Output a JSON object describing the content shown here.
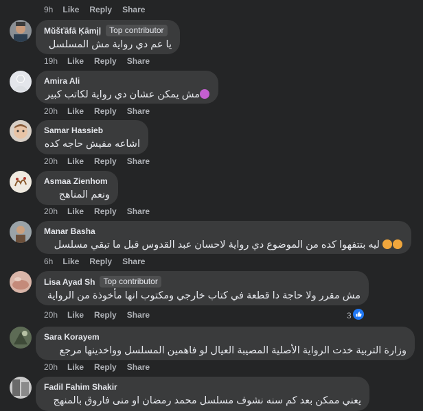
{
  "labels": {
    "like": "Like",
    "reply": "Reply",
    "share": "Share"
  },
  "top_actions": {
    "time": "9h"
  },
  "comments": [
    {
      "author": "Mŭšťāfā Ķāmįļ",
      "badge": "Top contributor",
      "text": "يا عم دي رواية مش المسلسل",
      "time": "19h"
    },
    {
      "author": "Amira Ali",
      "badge": "",
      "text": "مش يمكن عشان دي رواية لكاتب كبير",
      "time": "20h"
    },
    {
      "author": "Samar Hassieb",
      "badge": "",
      "text": "اشاعه مفيش حاجه كده",
      "time": "20h"
    },
    {
      "author": "Asmaa Zienhom",
      "badge": "",
      "text": "ونعم المناهج",
      "time": "20h"
    },
    {
      "author": "Manar Basha",
      "badge": "",
      "text": "ليه بتتفهوا كده من الموضوع دي رواية لاحسان عبد القدوس قبل ما تبقي مسلسل",
      "time": "6h"
    },
    {
      "author": "Lisa Ayad Sh",
      "badge": "Top contributor",
      "text": "مش مقرر ولا حاجة دا قطعة في كتاب خارجي ومكتوب انها مأخوذة من الرواية",
      "time": "20h",
      "reaction_count": "3"
    },
    {
      "author": "Sara Korayem",
      "badge": "",
      "text": "وزارة التربية خدت الرواية الأصلية المصيبة العيال لو فاهمين المسلسل وواخدينها مرجع",
      "time": "20h"
    },
    {
      "author": "Fadil Fahim Shakir",
      "badge": "",
      "text": "يعني ممكن بعد كم سنه نشوف مسلسل محمد رمضان او منى فاروق بالمنهج",
      "time": ""
    }
  ],
  "colors": {
    "background": "#242526",
    "bubble": "#3a3b3c",
    "meta": "#b0b3b8",
    "like_blue": "#2078f4"
  }
}
